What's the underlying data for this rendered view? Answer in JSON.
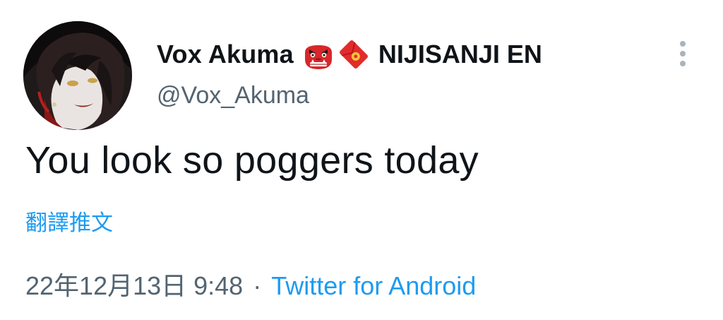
{
  "user": {
    "display_name": "Vox Akuma",
    "emoji_1": "oni-emoji",
    "emoji_2": "red-envelope-emoji",
    "affiliation": "NIJISANJI EN",
    "handle": "@Vox_Akuma",
    "avatar": "avatar-portrait"
  },
  "menu": {
    "icon": "more-vertical-icon"
  },
  "tweet": {
    "text": "You look so poggers today",
    "translate_label": "翻譯推文",
    "timestamp": "22年12月13日 9:48",
    "separator": "·",
    "source": "Twitter for Android"
  },
  "colors": {
    "text_primary": "#0f1419",
    "text_secondary": "#536471",
    "link": "#1d9bf0"
  }
}
